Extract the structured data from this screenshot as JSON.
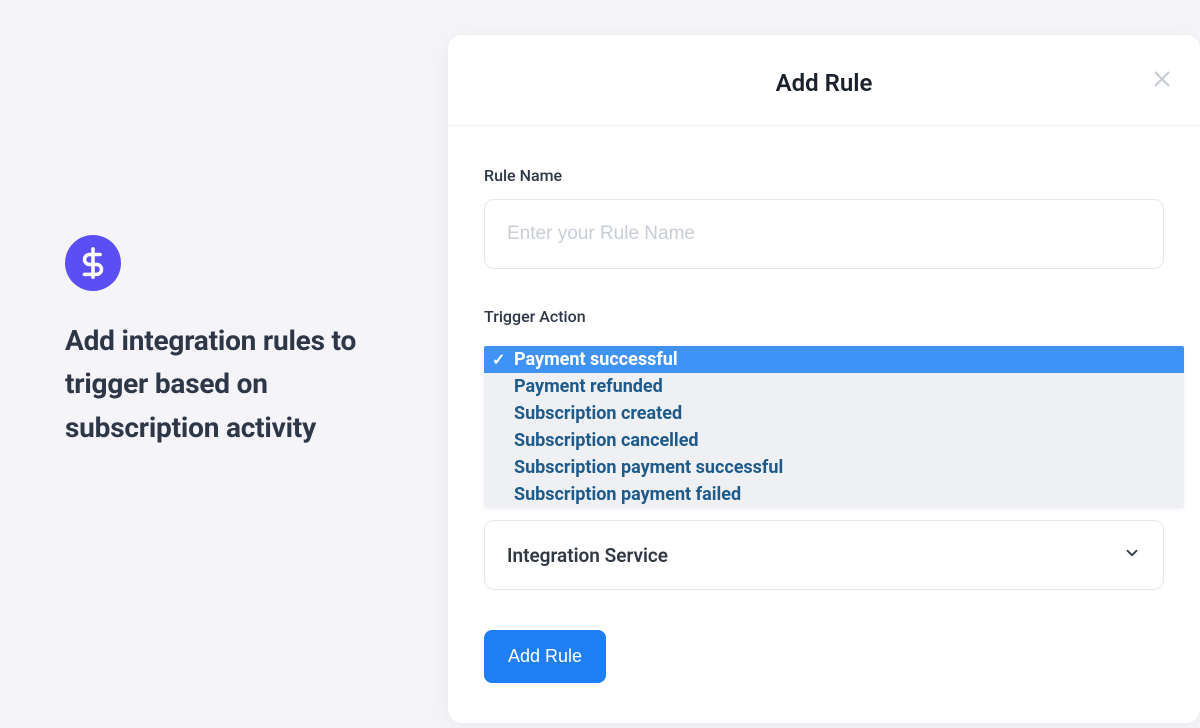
{
  "left": {
    "headline": "Add integration rules to trigger based on subscription activity",
    "icon": "dollar-icon"
  },
  "modal": {
    "title": "Add Rule",
    "close_icon": "close-icon",
    "rule_name": {
      "label": "Rule Name",
      "placeholder": "Enter your Rule Name",
      "value": ""
    },
    "trigger_action": {
      "label": "Trigger Action",
      "selected": "Payment successful",
      "options": [
        "Payment successful",
        "Payment refunded",
        "Subscription created",
        "Subscription cancelled",
        "Subscription payment successful",
        "Subscription payment failed"
      ]
    },
    "integration_service": {
      "label": "Integration Service"
    },
    "submit_label": "Add Rule"
  }
}
